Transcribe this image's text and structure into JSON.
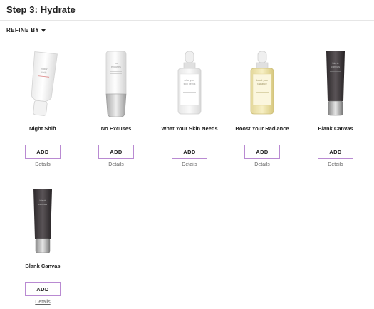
{
  "page": {
    "title": "Step 3: Hydrate"
  },
  "refine": {
    "label": "REFINE BY"
  },
  "products": [
    {
      "name": "Night Shift",
      "add_label": "ADD",
      "details_label": "Details",
      "image": "white-tube-icon",
      "tube_text": "night shift"
    },
    {
      "name": "No Excuses",
      "add_label": "ADD",
      "details_label": "Details",
      "image": "white-bottle-icon",
      "tube_text": "no excuses"
    },
    {
      "name": "What Your Skin Needs",
      "add_label": "ADD",
      "details_label": "Details",
      "image": "clear-dropper-bottle-icon",
      "tube_text": "what your skin needs"
    },
    {
      "name": "Boost Your Radiance",
      "add_label": "ADD",
      "details_label": "Details",
      "image": "yellow-dropper-bottle-icon",
      "tube_text": "boost your radiance"
    },
    {
      "name": "Blank Canvas",
      "add_label": "ADD",
      "details_label": "Details",
      "image": "dark-tube-icon",
      "tube_text": "blank canvas"
    },
    {
      "name": "Blank Canvas",
      "add_label": "ADD",
      "details_label": "Details",
      "image": "dark-tube-icon",
      "tube_text": "blank canvas"
    }
  ],
  "colors": {
    "accent_border": "#b98ad2",
    "text": "#222222",
    "link": "#666666"
  }
}
